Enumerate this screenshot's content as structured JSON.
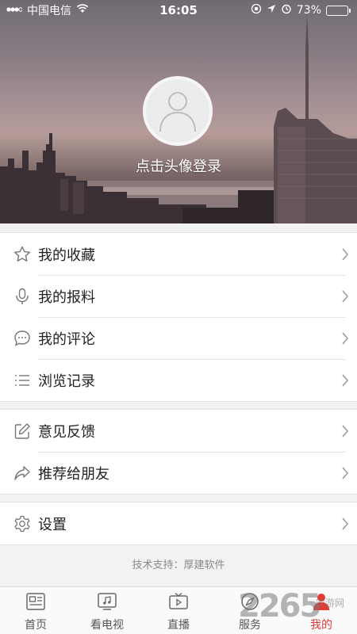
{
  "status_bar": {
    "carrier": "中国电信",
    "time": "16:05",
    "battery_percent": "73%",
    "battery_level": 0.73
  },
  "profile": {
    "login_prompt": "点击头像登录"
  },
  "menu_group_1": [
    {
      "label": "我的收藏",
      "icon": "star-icon"
    },
    {
      "label": "我的报料",
      "icon": "microphone-icon"
    },
    {
      "label": "我的评论",
      "icon": "comment-icon"
    },
    {
      "label": "浏览记录",
      "icon": "list-icon"
    }
  ],
  "menu_group_2": [
    {
      "label": "意见反馈",
      "icon": "edit-icon"
    },
    {
      "label": "推荐给朋友",
      "icon": "share-icon"
    }
  ],
  "menu_group_3": [
    {
      "label": "设置",
      "icon": "gear-icon"
    }
  ],
  "footer": {
    "tech_support": "技术支持：厚建软件"
  },
  "tabbar": {
    "tabs": [
      {
        "label": "首页",
        "icon": "news-icon"
      },
      {
        "label": "看电视",
        "icon": "tv-music-icon"
      },
      {
        "label": "直播",
        "icon": "live-tv-icon"
      },
      {
        "label": "服务",
        "icon": "compass-icon"
      },
      {
        "label": "我的",
        "icon": "user-icon",
        "active": true
      }
    ],
    "active_color": "#e53935"
  },
  "watermark": {
    "brand": "2265",
    "sub": "安游网"
  }
}
